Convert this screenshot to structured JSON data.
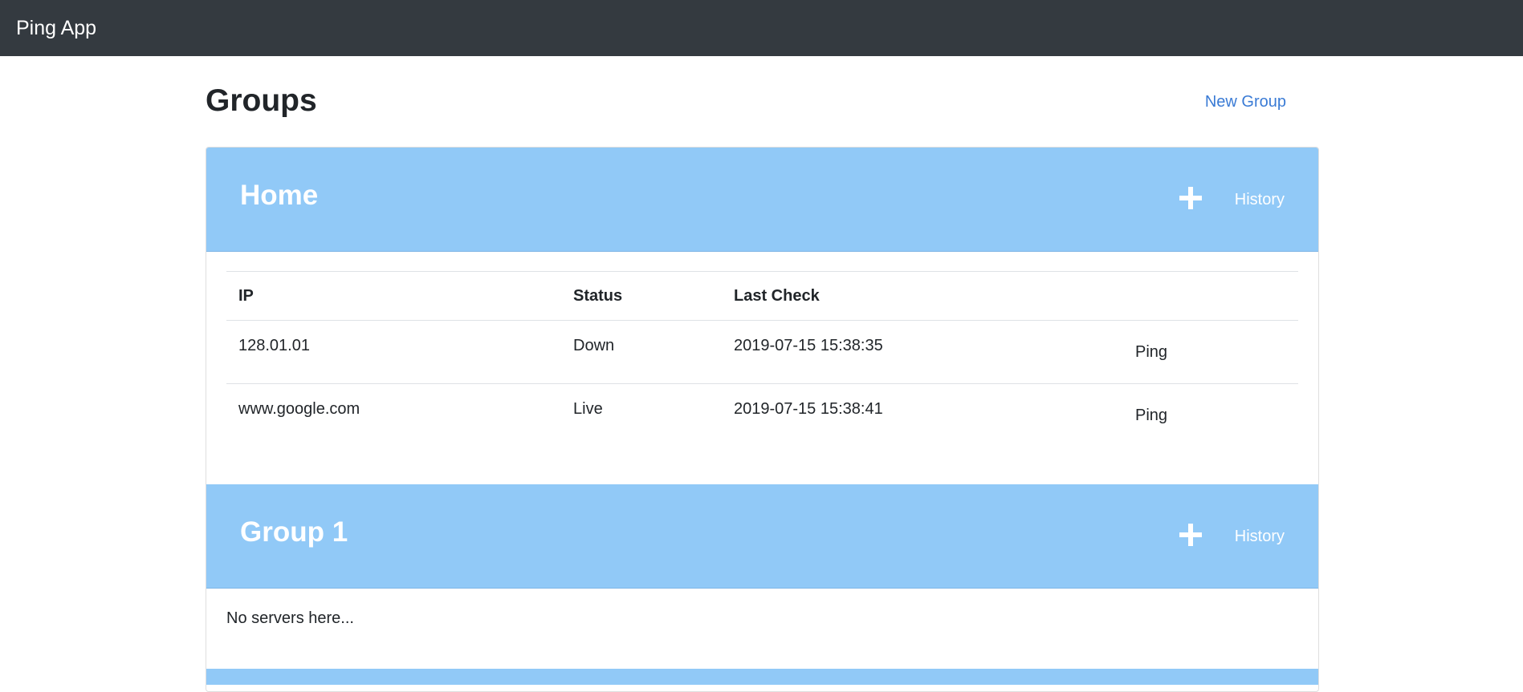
{
  "navbar": {
    "brand": "Ping App"
  },
  "page": {
    "title": "Groups",
    "new_group_label": "New Group"
  },
  "table_headers": {
    "ip": "IP",
    "status": "Status",
    "last_check": "Last Check"
  },
  "colors": {
    "navbar": "#343a40",
    "group_header": "#91c9f7",
    "link": "#3a7bd5"
  },
  "groups": [
    {
      "name": "Home",
      "add_icon": "plus-icon",
      "history_label": "History",
      "servers": [
        {
          "ip": "128.01.01",
          "status": "Down",
          "last_check": "2019-07-15 15:38:35",
          "action": "Ping"
        },
        {
          "ip": "www.google.com",
          "status": "Live",
          "last_check": "2019-07-15 15:38:41",
          "action": "Ping"
        }
      ]
    },
    {
      "name": "Group 1",
      "add_icon": "plus-icon",
      "history_label": "History",
      "empty_text": "No servers here..."
    }
  ]
}
